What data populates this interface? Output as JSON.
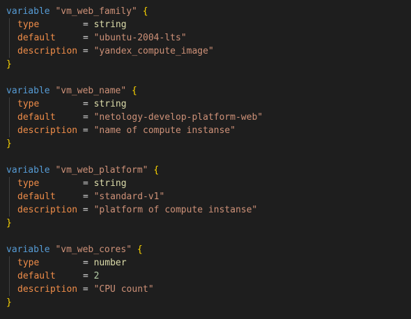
{
  "editor": {
    "blocks": [
      {
        "keyword": "variable",
        "name": "\"vm_web_family\"",
        "open": "{",
        "close": "}",
        "attrs": [
          {
            "key": "type",
            "pad": "        ",
            "op": "=",
            "value": "string",
            "kind": "type"
          },
          {
            "key": "default",
            "pad": "     ",
            "op": "=",
            "value": "\"ubuntu-2004-lts\"",
            "kind": "str"
          },
          {
            "key": "description",
            "pad": " ",
            "op": "=",
            "value": "\"yandex_compute_image\"",
            "kind": "str"
          }
        ]
      },
      {
        "keyword": "variable",
        "name": "\"vm_web_name\"",
        "open": "{",
        "close": "}",
        "attrs": [
          {
            "key": "type",
            "pad": "        ",
            "op": "=",
            "value": "string",
            "kind": "type"
          },
          {
            "key": "default",
            "pad": "     ",
            "op": "=",
            "value": "\"netology-develop-platform-web\"",
            "kind": "str"
          },
          {
            "key": "description",
            "pad": " ",
            "op": "=",
            "value": "\"name of compute instanse\"",
            "kind": "str"
          }
        ]
      },
      {
        "keyword": "variable",
        "name": "\"vm_web_platform\"",
        "open": "{",
        "close": "}",
        "attrs": [
          {
            "key": "type",
            "pad": "        ",
            "op": "=",
            "value": "string",
            "kind": "type"
          },
          {
            "key": "default",
            "pad": "     ",
            "op": "=",
            "value": "\"standard-v1\"",
            "kind": "str"
          },
          {
            "key": "description",
            "pad": " ",
            "op": "=",
            "value": "\"platform of compute instanse\"",
            "kind": "str"
          }
        ]
      },
      {
        "keyword": "variable",
        "name": "\"vm_web_cores\"",
        "open": "{",
        "close": "}",
        "attrs": [
          {
            "key": "type",
            "pad": "        ",
            "op": "=",
            "value": "number",
            "kind": "type"
          },
          {
            "key": "default",
            "pad": "     ",
            "op": "=",
            "value": "2",
            "kind": "num"
          },
          {
            "key": "description",
            "pad": " ",
            "op": "=",
            "value": "\"CPU count\"",
            "kind": "str"
          }
        ]
      }
    ]
  }
}
